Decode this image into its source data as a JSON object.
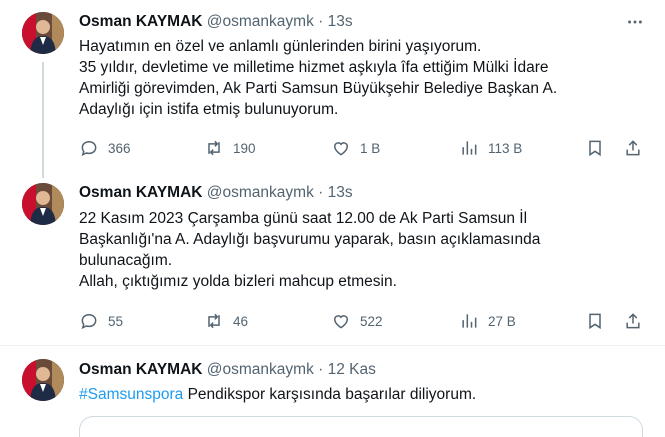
{
  "tweets": [
    {
      "name": "Osman KAYMAK",
      "handle": "@osmankaymk",
      "dot": "·",
      "time": "13s",
      "lines": [
        "Hayatımın en özel ve anlamlı günlerinden birini yaşıyorum.",
        "35 yıldır, devletime ve milletime hizmet aşkıyla îfa ettiğim Mülki İdare",
        "Amirliği görevimden, Ak Parti Samsun Büyükşehir Belediye Başkan A.",
        "Adaylığı için istifa etmiş bulunuyorum."
      ],
      "replies": "366",
      "retweets": "190",
      "likes": "1 B",
      "views": "113 B"
    },
    {
      "name": "Osman KAYMAK",
      "handle": "@osmankaymk",
      "dot": "·",
      "time": "13s",
      "lines": [
        "22 Kasım 2023 Çarşamba günü saat 12.00 de Ak Parti Samsun İl",
        "Başkanlığı'na A. Adaylığı başvurumu yaparak, basın açıklamasında",
        "bulunacağım.",
        "Allah, çıktığımız yolda bizleri mahcup etmesin."
      ],
      "replies": "55",
      "retweets": "46",
      "likes": "522",
      "views": "27 B"
    },
    {
      "name": "Osman KAYMAK",
      "handle": "@osmankaymk",
      "dot": "·",
      "time": "12 Kas",
      "hashtag": "#Samsunspora",
      "text": " Pendikspor karşısında başarılar diliyorum."
    }
  ],
  "colors": {
    "text": "#0f1419",
    "secondary": "#536471",
    "link": "#1d9bf0",
    "divider": "#eff3f4"
  }
}
